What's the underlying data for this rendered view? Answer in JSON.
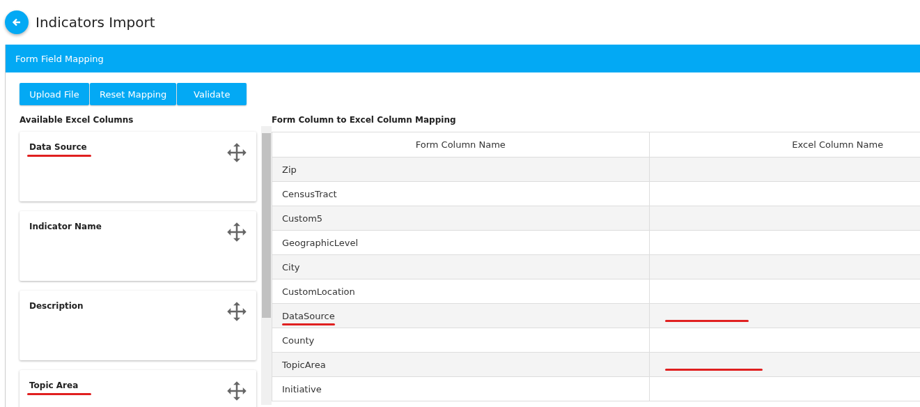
{
  "page": {
    "title": "Indicators Import"
  },
  "panel": {
    "title": "Form Field Mapping"
  },
  "buttons": [
    "Upload File",
    "Reset Mapping",
    "Validate"
  ],
  "available_columns": {
    "heading": "Available Excel Columns",
    "cards": [
      {
        "label": "Data Source",
        "underlined": true
      },
      {
        "label": "Indicator Name",
        "underlined": false
      },
      {
        "label": "Description",
        "underlined": false
      },
      {
        "label": "Topic Area",
        "underlined": true
      }
    ]
  },
  "mapping": {
    "heading": "Form Column to Excel Column Mapping",
    "columns": [
      "Form Column Name",
      "Excel Column Name"
    ],
    "rows": [
      {
        "form_column": "Zip",
        "form_underlined": false,
        "excel_underlined": false
      },
      {
        "form_column": "CensusTract",
        "form_underlined": false,
        "excel_underlined": false
      },
      {
        "form_column": "Custom5",
        "form_underlined": false,
        "excel_underlined": false
      },
      {
        "form_column": "GeographicLevel",
        "form_underlined": false,
        "excel_underlined": false
      },
      {
        "form_column": "City",
        "form_underlined": false,
        "excel_underlined": false
      },
      {
        "form_column": "CustomLocation",
        "form_underlined": false,
        "excel_underlined": false
      },
      {
        "form_column": "DataSource",
        "form_underlined": true,
        "excel_underlined": true
      },
      {
        "form_column": "County",
        "form_underlined": false,
        "excel_underlined": false
      },
      {
        "form_column": "TopicArea",
        "form_underlined": false,
        "excel_underlined": true
      },
      {
        "form_column": "Initiative",
        "form_underlined": false,
        "excel_underlined": false
      }
    ]
  }
}
